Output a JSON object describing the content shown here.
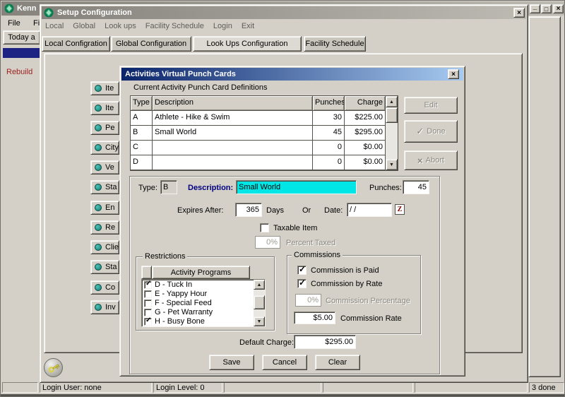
{
  "main_window": {
    "title": "Kenn",
    "menu": [
      "File",
      "File"
    ],
    "today_button": "Today a",
    "rebuild_text": "Rebuild",
    "status": {
      "login_user": "Login User: none",
      "login_level": "Login Level: 0",
      "done": "3 done"
    }
  },
  "setup_window": {
    "title": "Setup Configuration",
    "menu": [
      "Local",
      "Global",
      "Look ups",
      "Facility Schedule",
      "Login",
      "Exit"
    ],
    "tabs": [
      "Local Configration",
      "Global Configuration",
      "Look Ups Configuration",
      "Facility Schedule"
    ],
    "active_tab": "Look Ups Configuration",
    "sidebar_items": [
      "Ite",
      "Ite",
      "Pe",
      "City",
      "Ve",
      "Sta",
      "En",
      "Re",
      "Clie",
      "Sta",
      "Co",
      "Inv"
    ]
  },
  "dialog": {
    "title": "Activities Virtual Punch Cards",
    "definitions_label": "Current Activity Punch Card Definitions",
    "table": {
      "columns": [
        "Type",
        "Description",
        "Punches",
        "Charge"
      ],
      "rows": [
        {
          "type": "A",
          "description": "Athlete - Hike & Swim",
          "punches": "30",
          "charge": "$225.00"
        },
        {
          "type": "B",
          "description": "Small World",
          "punches": "45",
          "charge": "$295.00"
        },
        {
          "type": "C",
          "description": "",
          "punches": "0",
          "charge": "$0.00"
        },
        {
          "type": "D",
          "description": "",
          "punches": "0",
          "charge": "$0.00"
        }
      ]
    },
    "buttons": {
      "edit": "Edit",
      "done": "Done",
      "abort": "Abort"
    },
    "form": {
      "type_label": "Type:",
      "type_value": "B",
      "description_label": "Description:",
      "description_value": "Small World",
      "punches_label": "Punches:",
      "punches_value": "45",
      "expires_label": "Expires After:",
      "expires_value": "365",
      "days_label": "Days",
      "or_label": "Or",
      "date_label": "Date:",
      "date_value": "/ /",
      "taxable_label": "Taxable Item",
      "taxable_checked": false,
      "percent_taxed_value": "0%",
      "percent_taxed_label": "Percent Taxed",
      "restrictions": {
        "group_label": "Restrictions",
        "header": "Activity Programs",
        "items": [
          {
            "label": "D - Tuck In",
            "checked": true
          },
          {
            "label": "E - Yappy Hour",
            "checked": false
          },
          {
            "label": "F - Special Feed",
            "checked": false
          },
          {
            "label": "G - Pet Warranty",
            "checked": false
          },
          {
            "label": "H - Busy Bone",
            "checked": true
          }
        ]
      },
      "commissions": {
        "group_label": "Commissions",
        "paid": {
          "label": "Commission is Paid",
          "checked": true
        },
        "by_rate": {
          "label": "Commission by Rate",
          "checked": true
        },
        "percentage_value": "0%",
        "percentage_label": "Commission Percentage",
        "rate_value": "$5.00",
        "rate_label": "Commission Rate"
      },
      "default_charge_label": "Default Charge:",
      "default_charge_value": "$295.00",
      "save": "Save",
      "cancel": "Cancel",
      "clear": "Clear"
    }
  },
  "icons": {
    "close": "×",
    "minimize": "_",
    "maximize": "□",
    "check": "✓",
    "abort_x": "×",
    "up": "▲",
    "down": "▼",
    "calendar": "Z"
  },
  "colors": {
    "face": "#d4d0c8",
    "active_title_from": "#0a246a",
    "active_title_to": "#a6caf0",
    "inactive_title_from": "#85837c",
    "inactive_title_to": "#bdbab2",
    "selection_cyan": "#00e6e6",
    "description_label_navy": "#000080",
    "rebuild_red": "#9b1f1f",
    "navy_bar": "#1c2383",
    "bullet_teal": "#117c72",
    "key_yellow": "#ddd23e",
    "calendar_red": "#8b0000"
  }
}
